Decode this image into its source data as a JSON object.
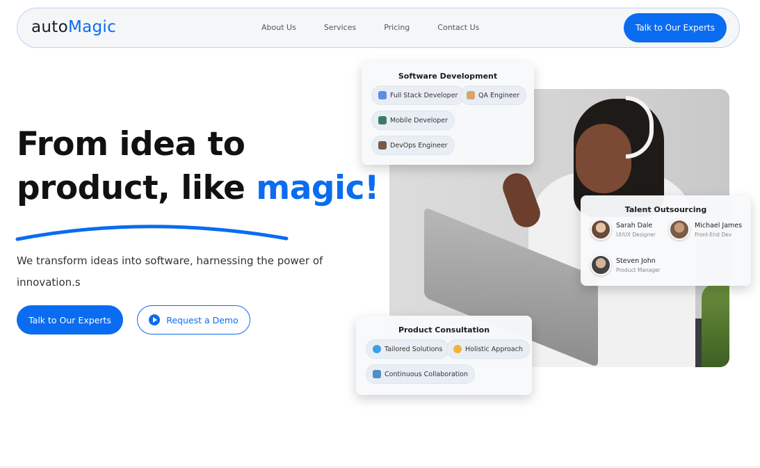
{
  "nav": {
    "logo_part1": "auto",
    "logo_part2": "Magic",
    "links": [
      "About Us",
      "Services",
      "Pricing",
      "Contact Us"
    ],
    "cta_label": "Talk to Our Experts"
  },
  "hero": {
    "headline_line1": "From idea to",
    "headline_line2_prefix": "product, like ",
    "headline_accent": "magic!",
    "subtext": "We transform ideas into software, harnessing the power of innovation.s",
    "primary_button": "Talk to Our Experts",
    "secondary_button": "Request a Demo"
  },
  "cards": {
    "software_dev": {
      "title": "Software Development",
      "chips": [
        {
          "label": "Full Stack Developer",
          "icon": "monitor-icon"
        },
        {
          "label": "QA Engineer",
          "icon": "people-icon"
        },
        {
          "label": "Mobile Developer",
          "icon": "phone-icon"
        },
        {
          "label": "DevOps Engineer",
          "icon": "team-icon"
        }
      ]
    },
    "talent": {
      "title": "Talent Outsourcing",
      "people": [
        {
          "name": "Sarah Dale",
          "role": "UI/UX Designer"
        },
        {
          "name": "Michael James",
          "role": "Front-End Dev"
        },
        {
          "name": "Steven John",
          "role": "Product Manager"
        }
      ]
    },
    "consultation": {
      "title": "Product Consultation",
      "chips": [
        {
          "label": "Tailored Solutions",
          "icon": "sparkle-icon"
        },
        {
          "label": "Holistic Approach",
          "icon": "bulb-icon"
        },
        {
          "label": "Continuous Collaboration",
          "icon": "collab-icon"
        }
      ]
    }
  },
  "colors": {
    "accent": "#0a6cf0",
    "text": "#111111",
    "card_bg": "#f8f9fb"
  }
}
